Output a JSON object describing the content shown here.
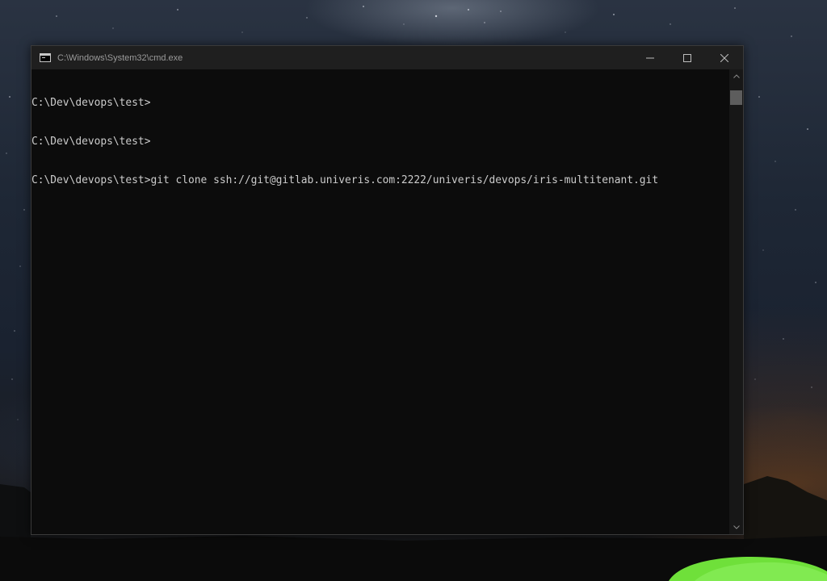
{
  "window": {
    "title": "C:\\Windows\\System32\\cmd.exe"
  },
  "icons": {
    "app": "cmd-icon",
    "minimize": "minimize-icon",
    "maximize": "maximize-icon",
    "close": "close-icon",
    "scroll_up": "chevron-up-icon",
    "scroll_down": "chevron-down-icon"
  },
  "console": {
    "lines": [
      "C:\\Dev\\devops\\test>",
      "C:\\Dev\\devops\\test>",
      "C:\\Dev\\devops\\test>git clone ssh://git@gitlab.univeris.com:2222/univeris/devops/iris-multitenant.git"
    ]
  },
  "colors": {
    "console_bg": "#0c0c0c",
    "console_text": "#cccccc",
    "titlebar_bg": "#1f1f1f",
    "tent_green": "#6fe03a"
  }
}
